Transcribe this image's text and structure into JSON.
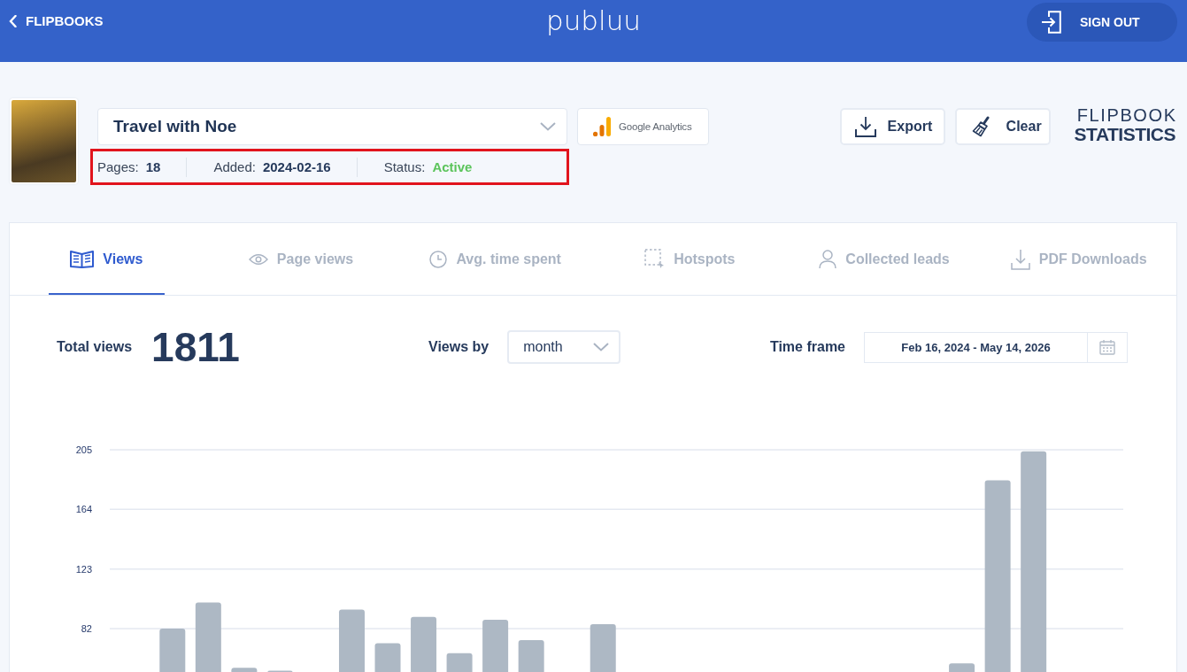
{
  "header": {
    "back_link": "FLIPBOOKS",
    "logo": "publuu",
    "sign_out_button": "SIGN OUT"
  },
  "flipbook": {
    "selector_value": "Travel with Noe",
    "analytics_button": "Google Analytics",
    "info_highlighted": true,
    "info": [
      {
        "kind": "plain",
        "label": "Pages:",
        "value": "18"
      },
      {
        "kind": "plain",
        "label": "Added:",
        "value": "2024-02-16"
      },
      {
        "kind": "status",
        "label": "Status:",
        "value": "Active"
      }
    ]
  },
  "actions": [
    {
      "kind": "export",
      "label": "Export"
    },
    {
      "kind": "clear",
      "label": "Clear"
    }
  ],
  "page_title": {
    "line_1": "FLIPBOOK",
    "line_2": "STATISTICS"
  },
  "tabs": [
    {
      "kind": "views",
      "label": "Views",
      "selected": true
    },
    {
      "kind": "page_views",
      "label": "Page views",
      "selected": false
    },
    {
      "kind": "time",
      "label": "Avg. time spent",
      "selected": false
    },
    {
      "kind": "hotspots",
      "label": "Hotspots",
      "selected": false
    },
    {
      "kind": "leads",
      "label": "Collected leads",
      "selected": false
    },
    {
      "kind": "downloads",
      "label": "PDF Downloads",
      "selected": false
    }
  ],
  "summary": {
    "total_label": "Total views",
    "total_value": "1811",
    "views_by_label": "Views by",
    "views_by_value": "month",
    "time_frame_label": "Time frame",
    "time_frame_value": "Feb 16, 2024 - May 14, 2026"
  },
  "chart_data": {
    "type": "bar",
    "grid": true,
    "ylim": [
      0,
      205
    ],
    "yticks": [
      82,
      123,
      164,
      205
    ],
    "values": [
      null,
      82,
      100,
      55,
      53,
      null,
      95,
      72,
      90,
      65,
      88,
      74,
      null,
      85,
      null,
      null,
      null,
      null,
      null,
      null,
      null,
      null,
      null,
      58,
      184,
      204,
      null,
      null
    ]
  }
}
